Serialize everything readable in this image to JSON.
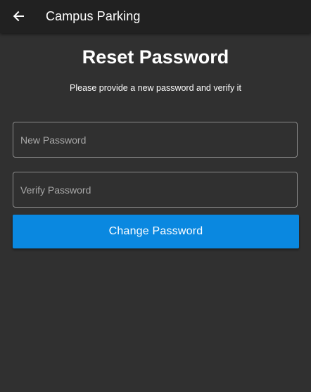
{
  "appbar": {
    "title": "Campus Parking",
    "back_icon": "arrow-left-icon"
  },
  "main": {
    "title": "Reset Password",
    "subtitle": "Please provide a new password and verify it",
    "new_password": {
      "placeholder": "New Password",
      "value": ""
    },
    "verify_password": {
      "placeholder": "Verify Password",
      "value": ""
    },
    "submit_label": "Change Password"
  },
  "colors": {
    "appbar_bg": "#212121",
    "page_bg": "#303030",
    "accent": "#0A88E0"
  }
}
